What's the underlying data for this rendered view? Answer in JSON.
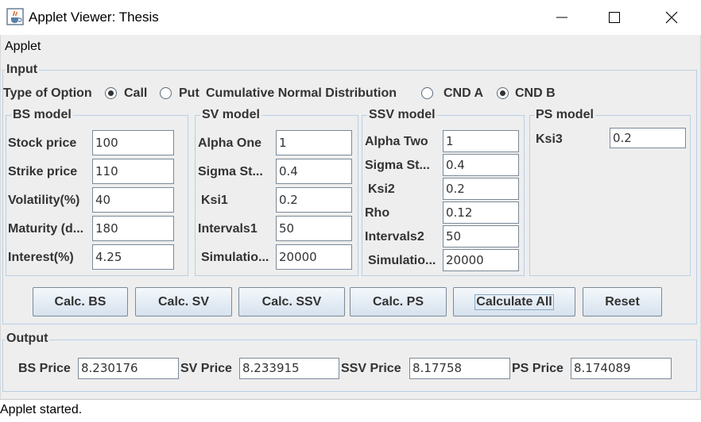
{
  "window": {
    "title": "Applet Viewer: Thesis"
  },
  "menu": {
    "applet": "Applet"
  },
  "input": {
    "legend": "Input",
    "type_label": "Type of Option",
    "call_label": "Call",
    "put_label": "Put",
    "cnd_label": "Cumulative Normal Distribution",
    "cnd_a_label": "CND A",
    "cnd_b_label": "CND B",
    "selected_option": "Call",
    "selected_cnd": "CND B"
  },
  "bs": {
    "legend": "BS model",
    "stock_label": "Stock price",
    "stock_value": "100",
    "strike_label": "Strike price",
    "strike_value": "110",
    "vol_label": "Volatility(%)",
    "vol_value": "40",
    "maturity_label": "Maturity (d...",
    "maturity_value": "180",
    "interest_label": "Interest(%)",
    "interest_value": "4.25"
  },
  "sv": {
    "legend": "SV model",
    "alpha_label": "Alpha One",
    "alpha_value": "1",
    "sigma_label": "Sigma St...",
    "sigma_value": "0.4",
    "ksi_label": "Ksi1",
    "ksi_value": "0.2",
    "intervals_label": "Intervals1",
    "intervals_value": "50",
    "sim_label": "Simulatio...",
    "sim_value": "20000"
  },
  "ssv": {
    "legend": "SSV model",
    "alpha_label": "Alpha Two",
    "alpha_value": "1",
    "sigma_label": "Sigma St...",
    "sigma_value": "0.4",
    "ksi_label": "Ksi2",
    "ksi_value": "0.2",
    "rho_label": "Rho",
    "rho_value": "0.12",
    "intervals_label": "Intervals2",
    "intervals_value": "50",
    "sim_label": "Simulatio...",
    "sim_value": "20000"
  },
  "ps": {
    "legend": "PS model",
    "ksi_label": "Ksi3",
    "ksi_value": "0.2"
  },
  "buttons": {
    "calc_bs": "Calc. BS",
    "calc_sv": "Calc. SV",
    "calc_ssv": "Calc. SSV",
    "calc_ps": "Calc. PS",
    "calc_all": "Calculate All",
    "reset": "Reset"
  },
  "output": {
    "legend": "Output",
    "bs_label": "BS Price",
    "bs_value": "8.230176",
    "sv_label": "SV Price",
    "sv_value": "8.233915",
    "ssv_label": "SSV Price",
    "ssv_value": "8.17758",
    "ps_label": "PS Price",
    "ps_value": "8.174089"
  },
  "status": {
    "text": "Applet started."
  },
  "icons": {
    "app": "java-cup-icon",
    "minimize": "minimize-icon",
    "maximize": "maximize-icon",
    "close": "close-icon"
  }
}
